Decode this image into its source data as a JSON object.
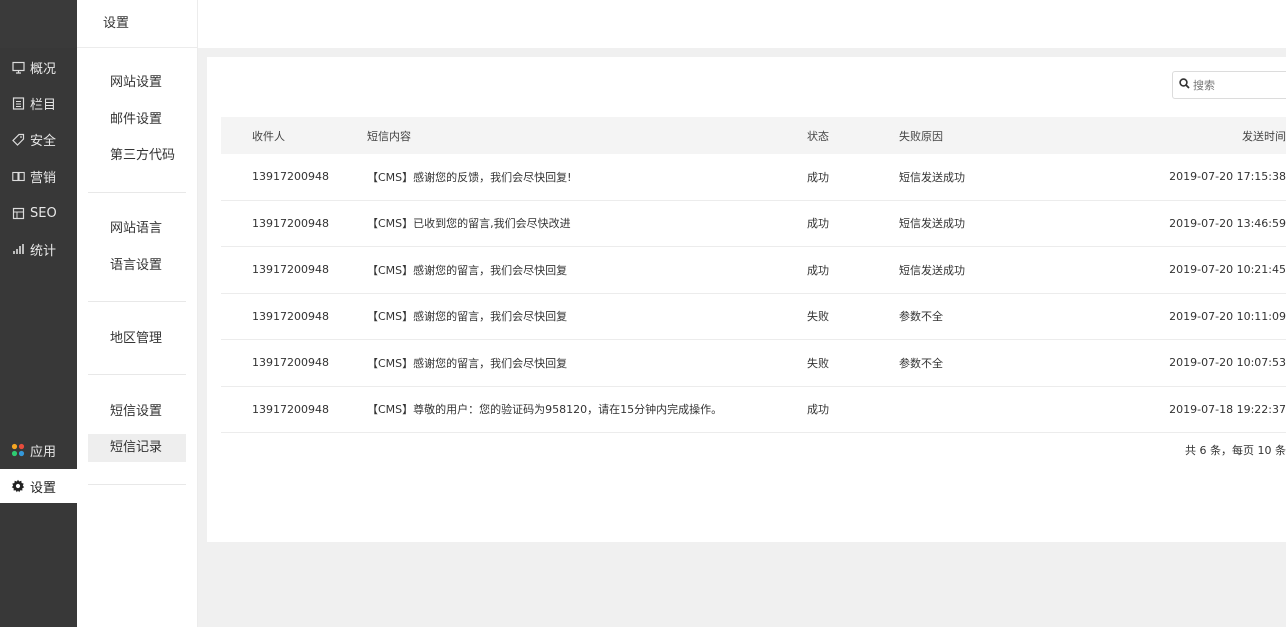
{
  "nav": {
    "items": [
      {
        "label": "概况",
        "icon": "monitor-icon"
      },
      {
        "label": "栏目",
        "icon": "list-icon"
      },
      {
        "label": "安全",
        "icon": "tag-icon"
      },
      {
        "label": "营销",
        "icon": "book-icon"
      },
      {
        "label": "SEO",
        "icon": "document-icon"
      },
      {
        "label": "统计",
        "icon": "bar-chart-icon"
      }
    ],
    "apps": {
      "label": "应用",
      "icon": "apps-icon"
    },
    "settings": {
      "label": "设置",
      "icon": "gear-icon"
    }
  },
  "submenu": {
    "title": "设置",
    "groups": [
      [
        "网站设置",
        "邮件设置",
        "第三方代码"
      ],
      [
        "网站语言",
        "语言设置"
      ],
      [
        "地区管理"
      ],
      [
        "短信设置",
        "短信记录"
      ]
    ],
    "active": "短信记录"
  },
  "search": {
    "placeholder": "搜索"
  },
  "table": {
    "headers": [
      "收件人",
      "短信内容",
      "状态",
      "失败原因",
      "发送时间"
    ],
    "rows": [
      [
        "13917200948",
        "【CMS】感谢您的反馈，我们会尽快回复!",
        "成功",
        "短信发送成功",
        "2019-07-20 17:15:38"
      ],
      [
        "13917200948",
        "【CMS】已收到您的留言,我们会尽快改进",
        "成功",
        "短信发送成功",
        "2019-07-20 13:46:59"
      ],
      [
        "13917200948",
        "【CMS】感谢您的留言，我们会尽快回复",
        "成功",
        "短信发送成功",
        "2019-07-20 10:21:45"
      ],
      [
        "13917200948",
        "【CMS】感谢您的留言，我们会尽快回复",
        "失败",
        "参数不全",
        "2019-07-20 10:11:09"
      ],
      [
        "13917200948",
        "【CMS】感谢您的留言，我们会尽快回复",
        "失败",
        "参数不全",
        "2019-07-20 10:07:53"
      ],
      [
        "13917200948",
        "【CMS】尊敬的用户：您的验证码为958120，请在15分钟内完成操作。",
        "成功",
        "",
        "2019-07-18 19:22:37"
      ]
    ]
  },
  "pager": {
    "summary": "共 6 条，每页 10 条"
  },
  "colors": {
    "nav_bg": "#383838",
    "active_nav_bg": "#ffffff",
    "page_bg": "#f0f0f0"
  }
}
